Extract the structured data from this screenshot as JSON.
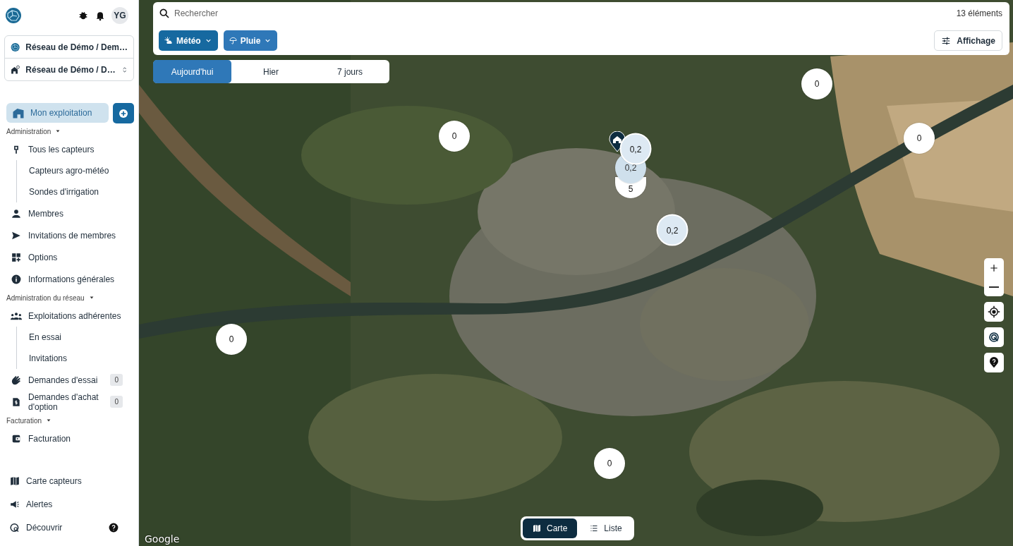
{
  "sidebar": {
    "avatar": "YG",
    "selectors": [
      {
        "label": "Réseau de Démo / Dem…",
        "kind": "network"
      },
      {
        "label": "Réseau de Démo / D…",
        "kind": "farm"
      }
    ],
    "primary": {
      "label": "Mon exploitation",
      "selected": true
    },
    "sections": [
      {
        "title": "Administration",
        "items": [
          {
            "label": "Tous les capteurs",
            "children": [
              {
                "label": "Capteurs agro-météo"
              },
              {
                "label": "Sondes d'irrigation"
              }
            ]
          },
          {
            "label": "Membres"
          },
          {
            "label": "Invitations de membres"
          },
          {
            "label": "Options"
          },
          {
            "label": "Informations générales"
          }
        ]
      },
      {
        "title": "Administration du réseau",
        "items": [
          {
            "label": "Exploitations adhérentes",
            "children": [
              {
                "label": "En essai"
              },
              {
                "label": "Invitations"
              }
            ]
          },
          {
            "label": "Demandes d'essai",
            "badge": "0"
          },
          {
            "label": "Demandes d'achat d'option",
            "badge": "0"
          }
        ]
      },
      {
        "title": "Facturation",
        "items": [
          {
            "label": "Facturation"
          }
        ]
      }
    ],
    "footer": [
      {
        "label": "Carte capteurs"
      },
      {
        "label": "Alertes"
      },
      {
        "label": "Découvrir",
        "help": true
      }
    ]
  },
  "search": {
    "placeholder": "Rechercher",
    "count": "13 éléments",
    "filters": [
      {
        "label": "Météo"
      },
      {
        "label": "Pluie"
      }
    ],
    "display_button": "Affichage"
  },
  "periods": [
    {
      "label": "Aujourd'hui",
      "selected": true
    },
    {
      "label": "Hier",
      "selected": false
    },
    {
      "label": "7 jours",
      "selected": false
    }
  ],
  "markers": [
    {
      "value": "0",
      "kind": "single"
    },
    {
      "value": "0",
      "kind": "single"
    },
    {
      "value": "0",
      "kind": "single"
    },
    {
      "value": "0,2",
      "kind": "active"
    },
    {
      "value": "0,2",
      "kind": "stack"
    },
    {
      "value": "5",
      "kind": "pill"
    },
    {
      "value": "0,2",
      "kind": "active"
    },
    {
      "value": "0",
      "kind": "single"
    },
    {
      "value": "0",
      "kind": "single"
    }
  ],
  "views": [
    {
      "label": "Carte",
      "selected": true
    },
    {
      "label": "Liste",
      "selected": false
    }
  ],
  "map_logo": "Google"
}
